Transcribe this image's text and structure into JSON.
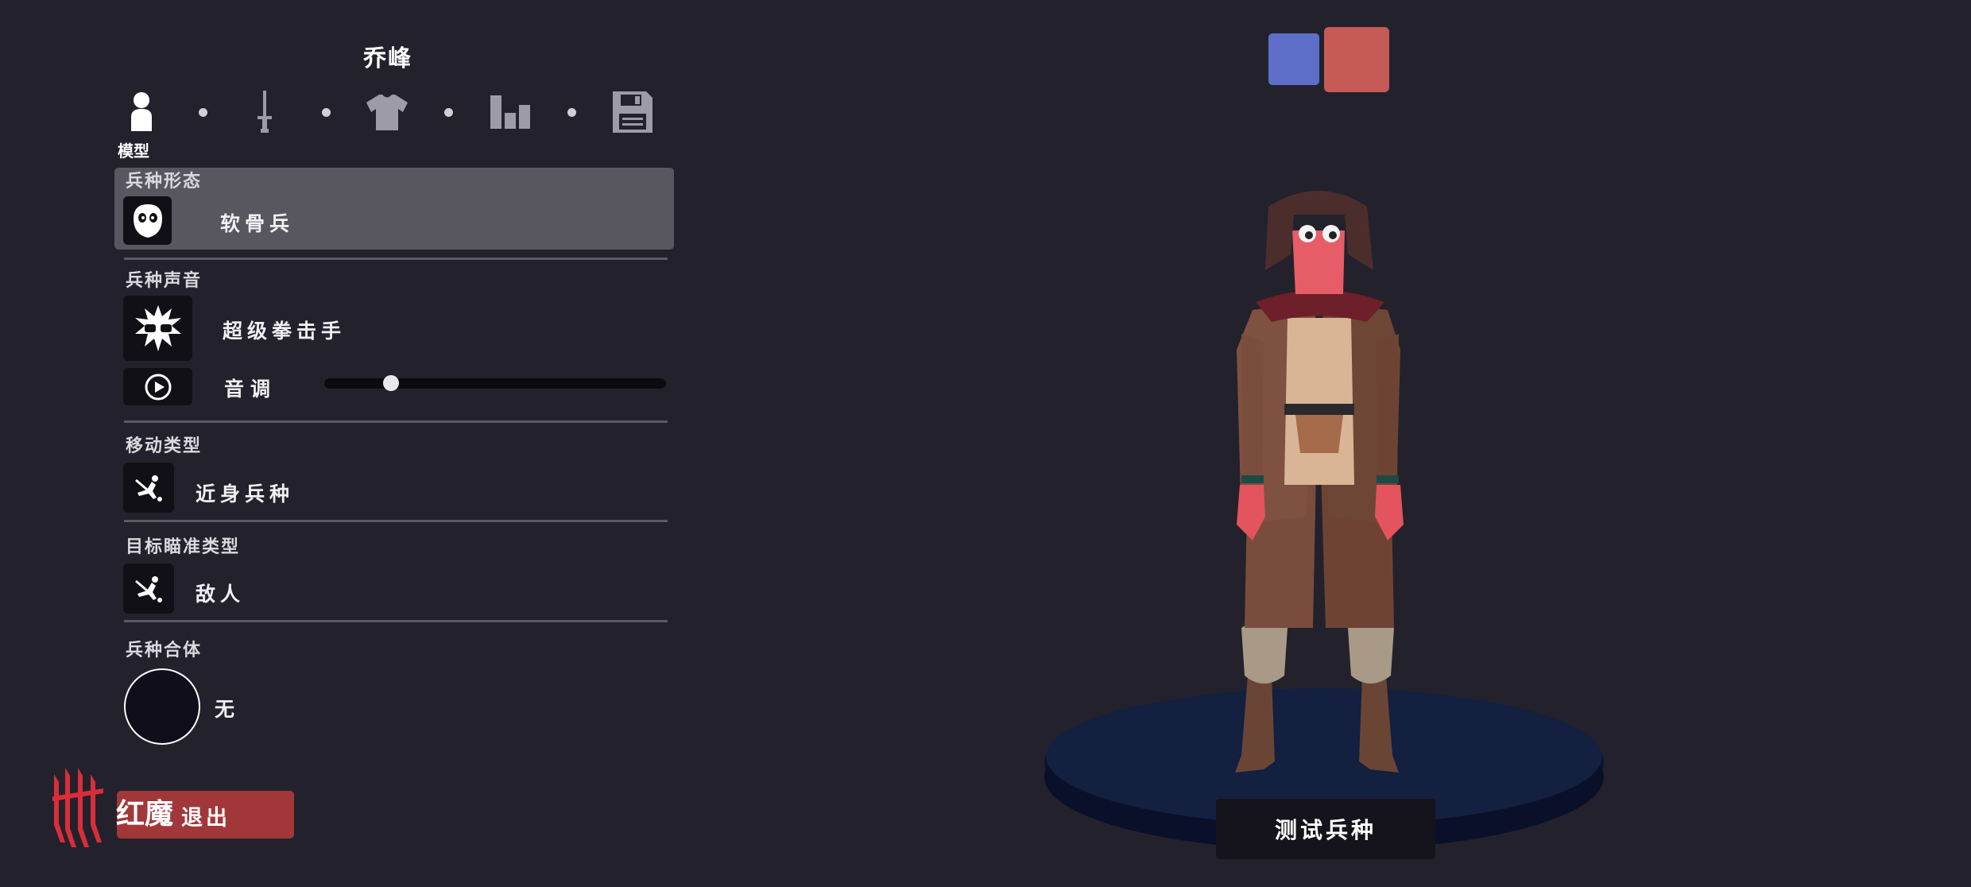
{
  "unit_name": "乔峰",
  "tabs": [
    {
      "id": "model",
      "icon": "person-icon",
      "label": "模型",
      "active": true
    },
    {
      "id": "weapon",
      "icon": "sword-icon",
      "active": false
    },
    {
      "id": "clothing",
      "icon": "shirt-icon",
      "active": false
    },
    {
      "id": "stats",
      "icon": "bar-chart-icon",
      "active": false
    },
    {
      "id": "save",
      "icon": "save-icon",
      "active": false
    }
  ],
  "sections": {
    "unit_form": {
      "title": "兵种形态",
      "value": "软骨兵",
      "icon": "mask-face-icon"
    },
    "unit_voice": {
      "title": "兵种声音",
      "value": "超级拳击手",
      "icon": "boxer-burst-icon",
      "pitch_label": "音调",
      "pitch_value": 0.18,
      "play_icon": "play-icon"
    },
    "movement_type": {
      "title": "移动类型",
      "value": "近身兵种",
      "icon": "melee-unit-icon"
    },
    "target_type": {
      "title": "目标瞄准类型",
      "value": "敌人",
      "icon": "target-enemy-icon"
    },
    "unit_combine": {
      "title": "兵种合体",
      "value": "无"
    }
  },
  "exit_label": "退出",
  "brand_text": "红魔",
  "brand_icon": "redmagic-logo-icon",
  "team_colors": {
    "blue": "#5d6ec9",
    "red": "#c65a57"
  },
  "test_button_label": "测试兵种",
  "colors": {
    "background": "#23222c",
    "selected_row": "#58575f",
    "exit_button": "#a2373a",
    "platform": "#14203f"
  }
}
